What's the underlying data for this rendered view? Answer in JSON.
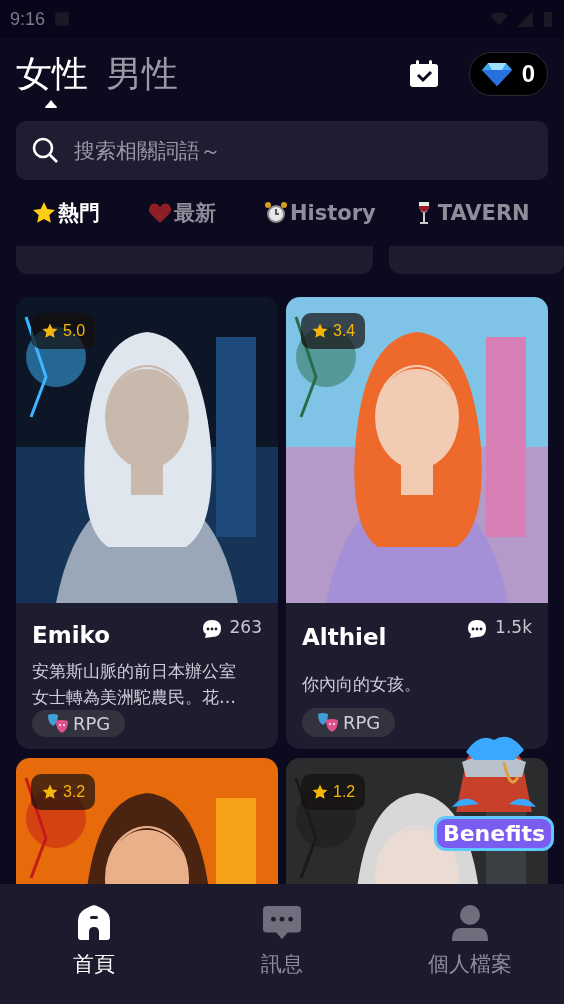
{
  "status_bar": {
    "time": "9:16"
  },
  "gender_tabs": [
    {
      "label": "女性",
      "selected": true
    },
    {
      "label": "男性",
      "selected": false
    }
  ],
  "diamonds": {
    "count": "0"
  },
  "search": {
    "placeholder": "搜索相關詞語～"
  },
  "categories": [
    {
      "kind": "star",
      "label": "熱門",
      "selected": true
    },
    {
      "kind": "heart",
      "label": "最新",
      "selected": false
    },
    {
      "kind": "clock",
      "label": "History",
      "selected": false
    },
    {
      "kind": "wine",
      "label": "TAVERN",
      "selected": false
    }
  ],
  "cards": [
    {
      "rating": "5.0",
      "name": "Emiko",
      "chats": "263",
      "description": "安第斯山脈的前日本辦公室女士轉為美洲駝農民。花…",
      "tag": "RPG"
    },
    {
      "rating": "3.4",
      "name": "Althiel",
      "chats": "1.5k",
      "description": "你內向的女孩。",
      "tag": "RPG"
    },
    {
      "rating": "3.2"
    },
    {
      "rating": "1.2"
    }
  ],
  "benefits": {
    "label": "Benefits"
  },
  "bottom_nav": [
    {
      "kind": "home",
      "label": "首頁",
      "selected": true
    },
    {
      "kind": "chat",
      "label": "訊息",
      "selected": false
    },
    {
      "kind": "person",
      "label": "個人檔案",
      "selected": false
    }
  ]
}
